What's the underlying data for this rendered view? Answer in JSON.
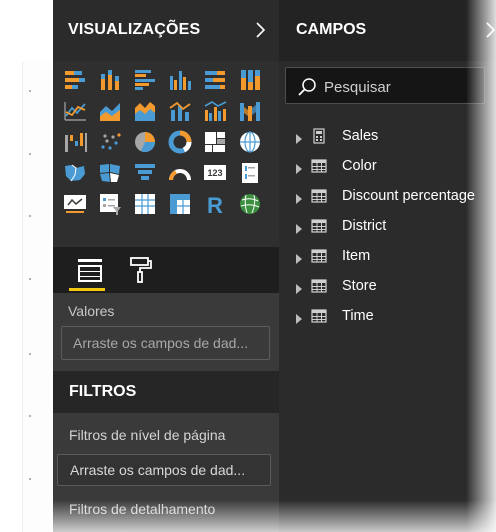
{
  "visualizations": {
    "title": "VISUALIZAÇÕES",
    "icons": [
      "stacked-bar-chart-icon",
      "stacked-column-chart-icon",
      "clustered-bar-chart-icon",
      "clustered-column-chart-icon",
      "100-percent-stacked-bar-chart-icon",
      "100-percent-stacked-column-chart-icon",
      "line-chart-icon",
      "area-chart-icon",
      "stacked-area-chart-icon",
      "line-and-stacked-column-chart-icon",
      "line-and-clustered-column-chart-icon",
      "ribbon-chart-icon",
      "waterfall-chart-icon",
      "scatter-chart-icon",
      "pie-chart-icon",
      "donut-chart-icon",
      "treemap-icon",
      "map-icon",
      "filled-map-icon",
      "shape-map-icon",
      "funnel-icon",
      "gauge-icon",
      "card-icon",
      "multi-row-card-icon",
      "kpi-icon",
      "slicer-icon",
      "table-icon",
      "matrix-icon",
      "r-script-visual-icon",
      "arcgis-map-icon"
    ],
    "selected_icon": "custom-visual-icon",
    "more_label": "···",
    "tabs": {
      "fields_icon": "fields-tab-icon",
      "format_icon": "paint-roller-icon"
    },
    "values_label": "Valores",
    "values_placeholder": "Arraste os campos de dad..."
  },
  "filters": {
    "title": "FILTROS",
    "page_level_label": "Filtros de nível de página",
    "page_level_placeholder": "Arraste os campos de dad...",
    "drillthrough_label": "Filtros de detalhamento"
  },
  "fields": {
    "title": "CAMPOS",
    "search_placeholder": "Pesquisar",
    "items": [
      {
        "label": "Sales",
        "icon": "calculator-icon"
      },
      {
        "label": "Color",
        "icon": "table-icon"
      },
      {
        "label": "Discount percentage",
        "icon": "table-icon"
      },
      {
        "label": "District",
        "icon": "table-icon"
      },
      {
        "label": "Item",
        "icon": "table-icon"
      },
      {
        "label": "Store",
        "icon": "table-icon"
      },
      {
        "label": "Time",
        "icon": "table-icon"
      }
    ]
  },
  "colors": {
    "accent_yellow": "#f2c811",
    "selection_magenta": "#e81bd6",
    "icon_blue": "#4a9bd4",
    "icon_orange": "#f29a2e",
    "icon_gray": "#a6a6a6"
  }
}
